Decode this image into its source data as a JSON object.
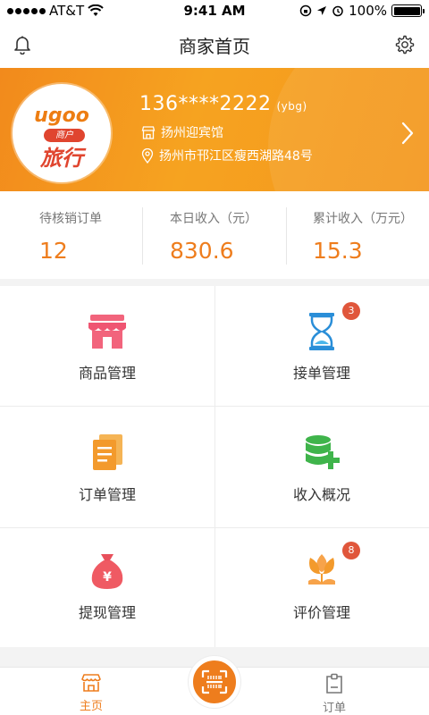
{
  "status_bar": {
    "carrier": "AT&T",
    "time": "9:41 AM",
    "battery_percent": "100%"
  },
  "header": {
    "title": "商家首页",
    "left_icon": "bell-icon",
    "right_icon": "gear-icon"
  },
  "merchant": {
    "logo_text_top": "ugoo",
    "logo_text_mid": "商户",
    "logo_text_bottom": "旅行",
    "account": "136****2222",
    "account_tag": "(ybg)",
    "shop_name": "扬州迎宾馆",
    "address": "扬州市邗江区瘦西湖路48号"
  },
  "stats": [
    {
      "label": "待核销订单",
      "value": "12"
    },
    {
      "label": "本日收入（元）",
      "value": "830.6"
    },
    {
      "label": "累计收入（万元）",
      "value": "15.3"
    }
  ],
  "menu": [
    {
      "label": "商品管理",
      "icon": "shop-icon",
      "badge": ""
    },
    {
      "label": "接单管理",
      "icon": "hourglass-icon",
      "badge": "3"
    },
    {
      "label": "订单管理",
      "icon": "document-icon",
      "badge": ""
    },
    {
      "label": "收入概况",
      "icon": "database-plus-icon",
      "badge": ""
    },
    {
      "label": "提现管理",
      "icon": "money-bag-icon",
      "badge": ""
    },
    {
      "label": "评价管理",
      "icon": "flower-icon",
      "badge": "8"
    }
  ],
  "tab_bar": {
    "home_label": "主页",
    "orders_label": "订单"
  },
  "colors": {
    "accent": "#ee7d1d",
    "badge": "#e0563b"
  }
}
